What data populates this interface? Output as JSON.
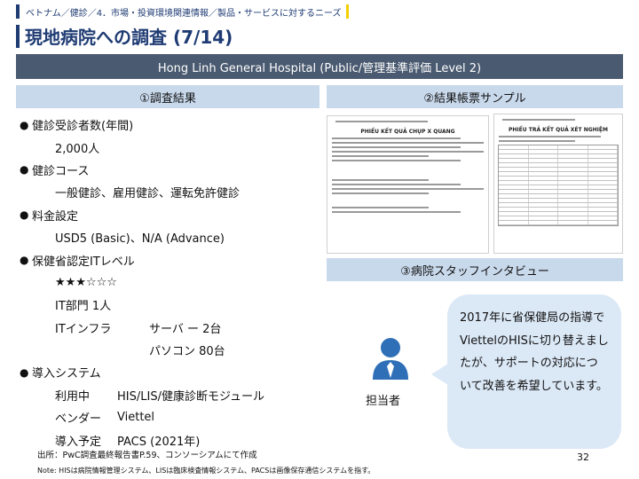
{
  "breadcrumb": "ベトナム／健診／4．市場・投資環境関連情報／製品・サービスに対するニーズ",
  "title": "現地病院への調査 (7/14)",
  "banner": "Hong Linh General Hospital (Public/管理基準評価 Level 2)",
  "sections": {
    "results": "①調査結果",
    "sample": "②結果帳票サンプル",
    "interview": "③病院スタッフインタビュー"
  },
  "results": {
    "capacity_label": "健診受診者数(年間)",
    "capacity_value": "2,000人",
    "courses_label": "健診コース",
    "courses_value": "一般健診、雇用健診、運転免許健診",
    "price_label": "料金設定",
    "price_value": "USD5 (Basic)、N/A (Advance)",
    "it_level_label": "保健省認定ITレベル",
    "it_level_stars": "★★★☆☆☆",
    "it_dept": "IT部門   1人",
    "it_infra_label": "ITインフラ",
    "servers": "サーバ ー   2台",
    "pcs": "パソコン   80台",
    "systems_label": "導入システム",
    "in_use_label": "利用中",
    "in_use_value": "HIS/LIS/健康診断モジュール",
    "vendor_label": "ベンダー",
    "vendor_value": "Viettel",
    "planned_label": "導入予定",
    "planned_value": "PACS (2021年)"
  },
  "sample_docs": {
    "doc1_title": "PHIẾU KẾT QUẢ CHỤP X QUANG",
    "doc2_title": "PHIẾU TRẢ KẾT QUẢ XÉT NGHIỆM"
  },
  "interview": {
    "role": "担当者",
    "quote": "2017年に省保健局の指導でViettelのHISに切り替えましたが、サポートの対応について改善を希望しています。"
  },
  "footer": {
    "source": "出所：PwC調査最終報告書P.59、コンソーシアムにて作成",
    "note": "Note: HISは病院情報管理システム、LISは臨床検査情報システム、PACSは画像保存通信システムを指す。",
    "page": "32"
  },
  "colors": {
    "navy": "#1f3b73",
    "banner": "#4a5a70",
    "section_head": "#c9d9ec",
    "bubble": "#dbe8f6",
    "avatar": "#2e6fb7",
    "accent_yellow": "#f5d000"
  }
}
